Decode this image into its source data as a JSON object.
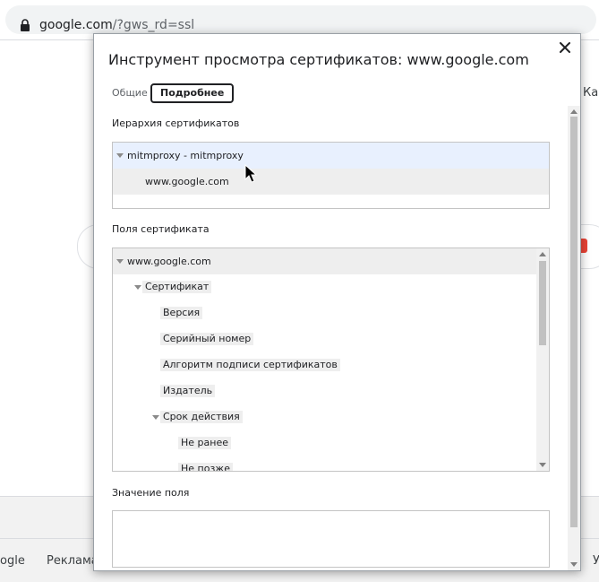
{
  "browser": {
    "url_host": "google.com",
    "url_path": "/?gws_rd=ssl"
  },
  "background": {
    "right_edge_text": "Кар",
    "footer_left_text": "ogle",
    "footer_ad_text": "Реклама",
    "footer_right_text": "У"
  },
  "dialog": {
    "title": "Инструмент просмотра сертификатов: www.google.com",
    "tabs": [
      {
        "label": "Общие",
        "active": false
      },
      {
        "label": "Подробнее",
        "active": true
      }
    ],
    "hierarchy": {
      "label": "Иерархия сертификатов",
      "items": [
        {
          "label": "mitmproxy - mitmproxy",
          "expanded": true,
          "selected": true
        },
        {
          "label": "www.google.com",
          "expanded": false,
          "selected": false
        }
      ]
    },
    "fields": {
      "label": "Поля сертификата",
      "items": [
        {
          "label": "www.google.com",
          "expanded": true
        },
        {
          "label": "Сертификат",
          "expanded": true
        },
        {
          "label": "Версия"
        },
        {
          "label": "Серийный номер"
        },
        {
          "label": "Алгоритм подписи сертификатов"
        },
        {
          "label": "Издатель"
        },
        {
          "label": "Срок действия",
          "expanded": true
        },
        {
          "label": "Не ранее"
        },
        {
          "label": "Не позже"
        }
      ]
    },
    "field_value": {
      "label": "Значение поля",
      "value": ""
    }
  },
  "icons": {
    "lock": "lock-icon",
    "close": "close-icon",
    "cursor": "mouse-pointer-icon"
  },
  "colors": {
    "selected_row": "#e8f0fe",
    "hover_row": "#eeeeee",
    "scrollbar_thumb": "#c1c1c1"
  }
}
